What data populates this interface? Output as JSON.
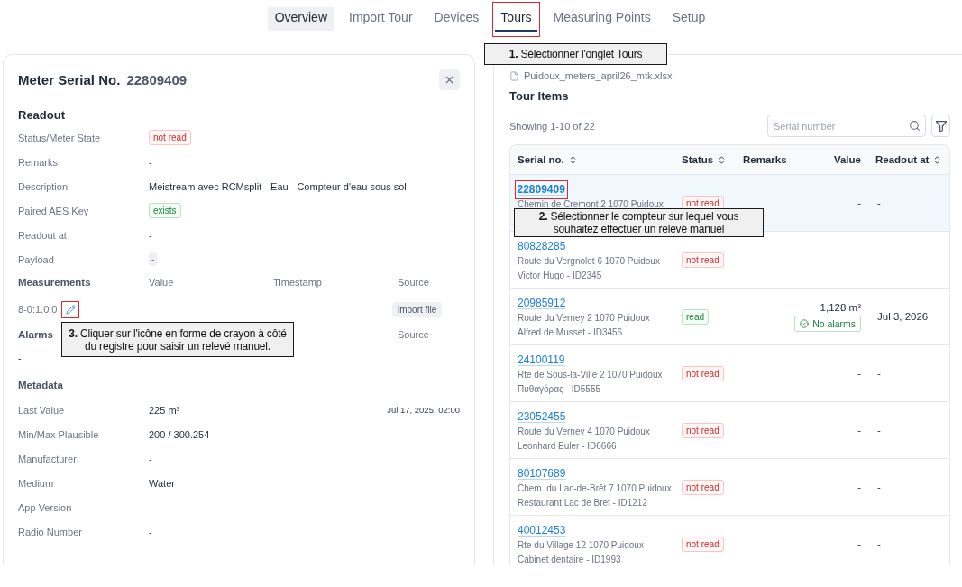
{
  "tabs": [
    {
      "label": "Overview",
      "selected": false,
      "hovered": true,
      "highlighted": false
    },
    {
      "label": "Import Tour",
      "selected": false,
      "hovered": false,
      "highlighted": false
    },
    {
      "label": "Devices",
      "selected": false,
      "hovered": false,
      "highlighted": false
    },
    {
      "label": "Tours",
      "selected": true,
      "hovered": false,
      "highlighted": true
    },
    {
      "label": "Measuring Points",
      "selected": false,
      "hovered": false,
      "highlighted": false
    },
    {
      "label": "Setup",
      "selected": false,
      "hovered": false,
      "highlighted": false
    }
  ],
  "meter_panel": {
    "title": "Meter Serial No.",
    "serial": "22809409",
    "readout": {
      "title": "Readout",
      "fields": [
        {
          "label": "Status/Meter State",
          "kind": "badge",
          "badge": {
            "label": "not read",
            "kind": "danger"
          }
        },
        {
          "label": "Remarks",
          "kind": "text",
          "value": "-"
        },
        {
          "label": "Description",
          "kind": "text",
          "value": "Meistream avec RCMsplit - Eau - Compteur d'eau sous sol"
        },
        {
          "label": "Paired AES Key",
          "kind": "badge",
          "badge": {
            "label": "exists",
            "kind": "success"
          }
        },
        {
          "label": "Readout at",
          "kind": "text",
          "value": "-"
        },
        {
          "label": "Payload",
          "kind": "code",
          "value": "-"
        }
      ]
    },
    "measurements": {
      "title": "Measurements",
      "columns": [
        "Value",
        "Timestamp",
        "Source"
      ],
      "rows": [
        {
          "register": "8-0:1.0.0",
          "highlighted": true,
          "source": "import file"
        }
      ]
    },
    "alarms": {
      "title": "Alarms",
      "source_header": "Source",
      "empty": "-"
    },
    "metadata": {
      "title": "Metadata",
      "fields": [
        {
          "label": "Last Value",
          "value": "225 m³",
          "timestamp": "Jul 17, 2025, 02:00"
        },
        {
          "label": "Min/Max Plausible",
          "value": "200 / 300.254"
        },
        {
          "label": "Manufacturer",
          "value": "-"
        },
        {
          "label": "Medium",
          "value": "Water"
        },
        {
          "label": "App Version",
          "value": "-"
        },
        {
          "label": "Radio Number",
          "value": "-"
        }
      ]
    }
  },
  "tour_panel": {
    "file": "Puidoux_meters_april26_mtk.xlsx",
    "title": "Tour Items",
    "summary": "Showing 1-10 of 22",
    "search": {
      "placeholder": "Serial number"
    },
    "table": {
      "columns": [
        {
          "label": "Serial no.",
          "sortable": true
        },
        {
          "label": "Status",
          "sortable": true
        },
        {
          "label": "Remarks",
          "sortable": false
        },
        {
          "label": "Value",
          "sortable": false
        },
        {
          "label": "Readout at",
          "sortable": true
        }
      ],
      "rows": [
        {
          "serial": "22809409",
          "address": "Chemin de Cremont 2 1070 Puidoux",
          "status": {
            "label": "not read",
            "kind": "danger"
          },
          "value": "-",
          "readout_at": "-",
          "selected": true,
          "highlighted": true
        },
        {
          "serial": "80828285",
          "address": "Route du Vergnolet 6 1070 Puidoux",
          "owner": "Victor Hugo - ID2345",
          "status": {
            "label": "not read",
            "kind": "danger"
          },
          "value": "-",
          "readout_at": "-",
          "selected": false,
          "highlighted": false
        },
        {
          "serial": "20985912",
          "address": "Route du Verney 2 1070 Puidoux",
          "owner": "Alfred de Musset - ID3456",
          "status": {
            "label": "read",
            "kind": "success"
          },
          "value": "1,128 m³",
          "alarm": {
            "label": "No alarms",
            "kind": "success"
          },
          "readout_at": "Jul 3, 2026",
          "selected": false,
          "highlighted": false
        },
        {
          "serial": "24100119",
          "address": "Rte de Sous-la-Ville 2 1070 Puidoux",
          "owner": "Πυθαγόρας - ID5555",
          "status": {
            "label": "not read",
            "kind": "danger"
          },
          "value": "-",
          "readout_at": "-",
          "selected": false,
          "highlighted": false
        },
        {
          "serial": "23052455",
          "address": "Route du Verney 4 1070 Puidoux",
          "owner": "Leonhard Euler - ID6666",
          "status": {
            "label": "not read",
            "kind": "danger"
          },
          "value": "-",
          "readout_at": "-",
          "selected": false,
          "highlighted": false
        },
        {
          "serial": "80107689",
          "address": "Chem. du Lac-de-Brêt 7 1070 Puidoux",
          "owner": "Restaurant Lac de Bret - ID1212",
          "status": {
            "label": "not read",
            "kind": "danger"
          },
          "value": "-",
          "readout_at": "-",
          "selected": false,
          "highlighted": false
        },
        {
          "serial": "40012453",
          "address": "Rte du Village 12 1070 Puidoux",
          "owner": "Cabinet dentaire - ID1993",
          "status": {
            "label": "not read",
            "kind": "danger"
          },
          "value": "-",
          "readout_at": "-",
          "selected": false,
          "highlighted": false
        }
      ]
    }
  },
  "callouts": [
    {
      "text": "**1.** Sélectionner l'onglet Tours"
    },
    {
      "text": "**2.** Sélectionner le compteur sur lequel vous souhaitez effectuer un relevé manuel"
    },
    {
      "text": "**3.** Cliquer sur l'icône en forme de crayon à côté du registre pour saisir un relevé manuel."
    }
  ]
}
